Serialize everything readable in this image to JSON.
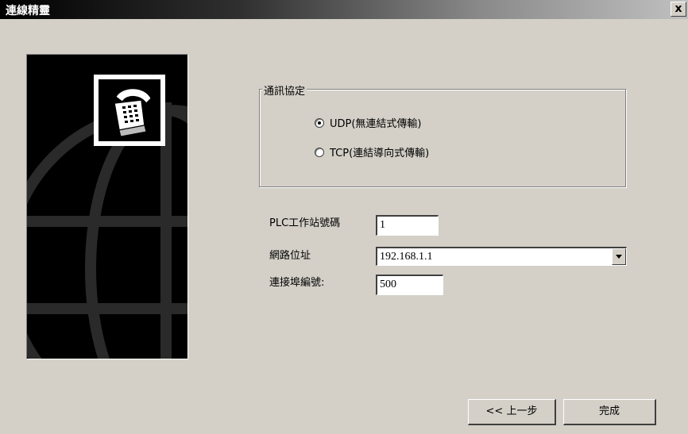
{
  "window": {
    "title": "連線精靈",
    "close_label": "x"
  },
  "protocol": {
    "legend": "通訊協定",
    "options": [
      {
        "label": "UDP(無連結式傳輸)",
        "checked": true
      },
      {
        "label": "TCP(連結導向式傳輸)",
        "checked": false
      }
    ]
  },
  "form": {
    "station_label": "PLC工作站號碼",
    "station_value": "1",
    "address_label": "網路位址",
    "address_value": "192.168.1.1",
    "port_label": "連接埠編號:",
    "port_value": "500"
  },
  "buttons": {
    "back_label": "<< 上一步",
    "finish_label": "完成"
  },
  "icons": {
    "side_image": "telephone-icon",
    "background": "globe-graphic",
    "dropdown": "chevron-down-icon"
  }
}
